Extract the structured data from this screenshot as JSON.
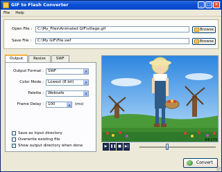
{
  "window": {
    "title": "GIF to Flash Converter"
  },
  "menu": {
    "items": [
      "File",
      "Help"
    ]
  },
  "files": {
    "open_label": "Open File :",
    "open_value": "C:\\My_Files\\Animated GIF\\village.gif",
    "save_label": "Save File :",
    "save_value": "C:\\My GIF\\File.swf",
    "browse_label": "Browse"
  },
  "tabs": [
    {
      "label": "Output"
    },
    {
      "label": "Resize"
    },
    {
      "label": "SWF"
    }
  ],
  "output": {
    "format_label": "Output Format :",
    "format_value": "SWF",
    "color_label": "Color Mode :",
    "color_value": "Lowest (8 bit)",
    "palette_label": "Palette :",
    "palette_value": "Websafe",
    "delay_label": "Frame Delay :",
    "delay_value": "100",
    "delay_unit": "(ms)"
  },
  "options": [
    {
      "label": "Save as input directory",
      "checked": false
    },
    {
      "label": "Overwrite existing file",
      "checked": false
    },
    {
      "label": "Show output directory when done",
      "checked": true
    }
  ],
  "player": {
    "frame_counter": "64/179",
    "progress": 0.36
  },
  "convert_label": "Convert"
}
